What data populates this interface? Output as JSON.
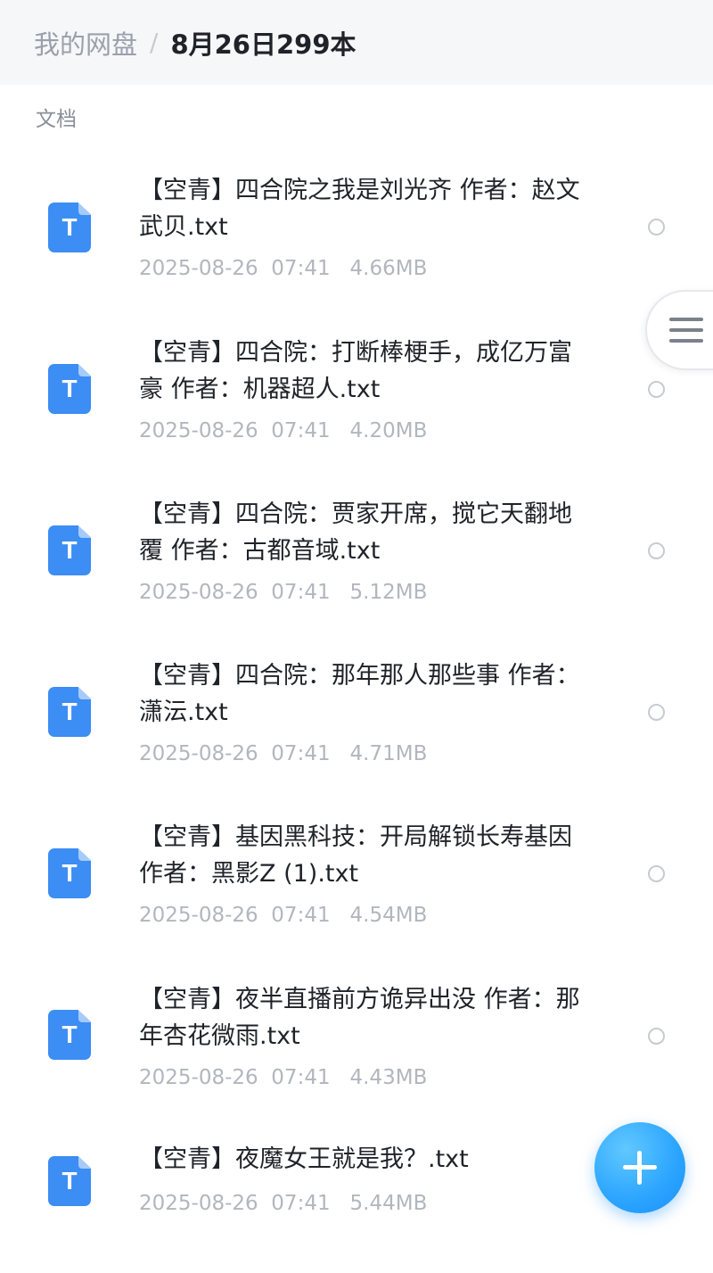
{
  "header": {
    "root": "我的网盘",
    "separator": "/",
    "current": "8月26日299本"
  },
  "section_label": "文档",
  "files": [
    {
      "icon_letter": "T",
      "name": "【空青】四合院之我是刘光齐 作者：赵文武贝.txt",
      "date": "2025-08-26",
      "time": "07:41",
      "size": "4.66MB"
    },
    {
      "icon_letter": "T",
      "name": "【空青】四合院：打断棒梗手，成亿万富豪 作者：机器超人.txt",
      "date": "2025-08-26",
      "time": "07:41",
      "size": "4.20MB"
    },
    {
      "icon_letter": "T",
      "name": "【空青】四合院：贾家开席，搅它天翻地覆 作者：古都音域.txt",
      "date": "2025-08-26",
      "time": "07:41",
      "size": "5.12MB"
    },
    {
      "icon_letter": "T",
      "name": "【空青】四合院：那年那人那些事 作者：潇沄.txt",
      "date": "2025-08-26",
      "time": "07:41",
      "size": "4.71MB"
    },
    {
      "icon_letter": "T",
      "name": "【空青】基因黑科技：开局解锁长寿基因 作者：黑影Z (1).txt",
      "date": "2025-08-26",
      "time": "07:41",
      "size": "4.54MB"
    },
    {
      "icon_letter": "T",
      "name": "【空青】夜半直播前方诡异出没 作者：那年杏花微雨.txt",
      "date": "2025-08-26",
      "time": "07:41",
      "size": "4.43MB"
    },
    {
      "icon_letter": "T",
      "name": "【空青】夜魔女王就是我？.txt",
      "date": "2025-08-26",
      "time": "07:41",
      "size": "5.44MB"
    }
  ],
  "icons": {
    "file": "txt-file-icon",
    "select": "radio-circle-icon",
    "side_menu": "hamburger-menu-icon",
    "fab": "plus-icon"
  },
  "colors": {
    "file_icon": "#3c8df4",
    "fab": "#2aa4ff",
    "header_bg": "#f6f7f9"
  }
}
